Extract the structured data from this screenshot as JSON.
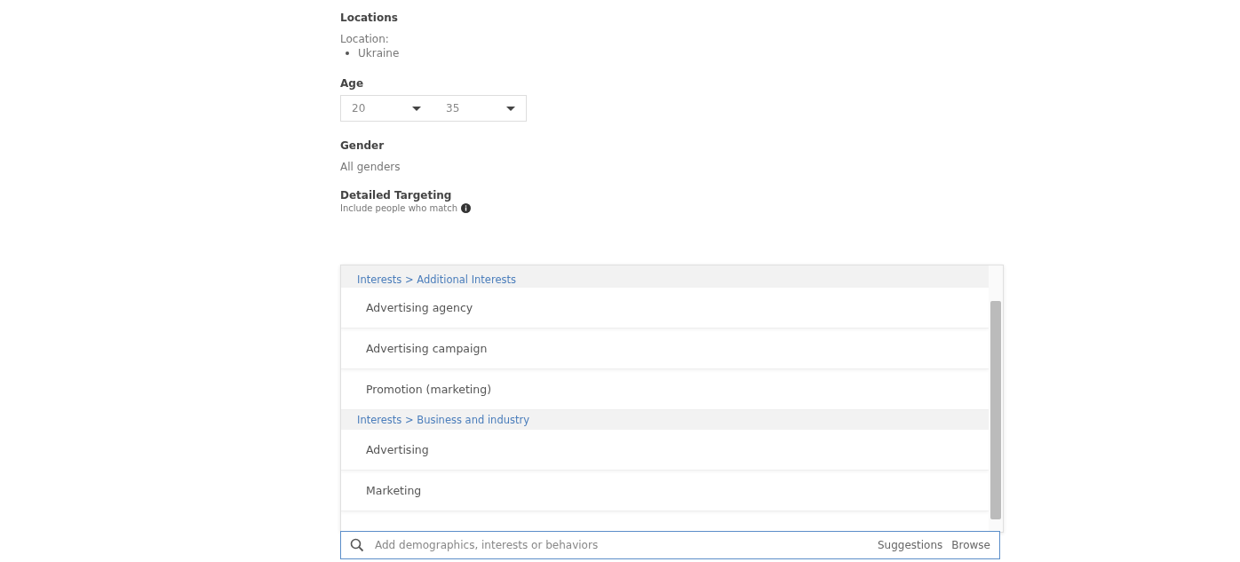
{
  "locations": {
    "title": "Locations",
    "label": "Location:",
    "items": [
      "Ukraine"
    ]
  },
  "age": {
    "title": "Age",
    "min": "20",
    "max": "35"
  },
  "gender": {
    "title": "Gender",
    "value": "All genders"
  },
  "detailed_targeting": {
    "title": "Detailed Targeting",
    "subtitle": "Include people who match",
    "list": [
      {
        "kind": "header",
        "label": "Interests > Additional Interests"
      },
      {
        "kind": "option",
        "label": "Advertising agency"
      },
      {
        "kind": "option",
        "label": "Advertising campaign"
      },
      {
        "kind": "option",
        "label": "Promotion (marketing)"
      },
      {
        "kind": "header",
        "label": "Interests > Business and industry"
      },
      {
        "kind": "option",
        "label": "Advertising"
      },
      {
        "kind": "option",
        "label": "Marketing"
      }
    ],
    "search": {
      "placeholder": "Add demographics, interests or behaviors",
      "links": [
        "Suggestions",
        "Browse"
      ]
    }
  }
}
